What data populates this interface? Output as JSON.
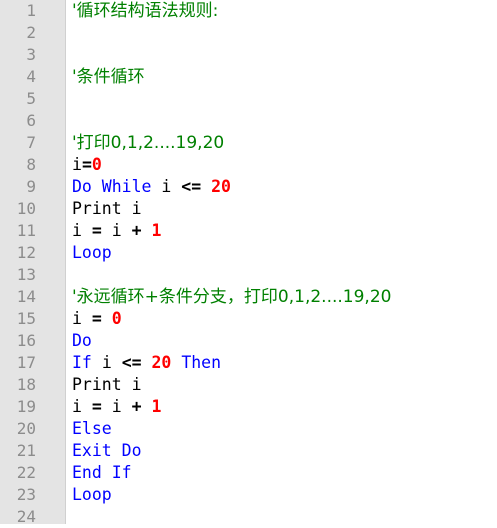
{
  "editor": {
    "lines": [
      {
        "num": "1",
        "tokens": [
          {
            "t": "comment",
            "v": "'循环结构语法规则:"
          }
        ]
      },
      {
        "num": "2",
        "tokens": []
      },
      {
        "num": "3",
        "tokens": []
      },
      {
        "num": "4",
        "tokens": [
          {
            "t": "comment",
            "v": "'条件循环"
          }
        ]
      },
      {
        "num": "5",
        "tokens": []
      },
      {
        "num": "6",
        "tokens": []
      },
      {
        "num": "7",
        "tokens": [
          {
            "t": "comment",
            "v": "'打印0,1,2....19,20"
          }
        ]
      },
      {
        "num": "8",
        "tokens": [
          {
            "t": "ident",
            "v": "i"
          },
          {
            "t": "op",
            "v": "="
          },
          {
            "t": "number",
            "v": "0"
          }
        ]
      },
      {
        "num": "9",
        "tokens": [
          {
            "t": "keyword",
            "v": "Do While"
          },
          {
            "t": "ws",
            "v": " "
          },
          {
            "t": "ident",
            "v": "i"
          },
          {
            "t": "ws",
            "v": " "
          },
          {
            "t": "op",
            "v": "<="
          },
          {
            "t": "ws",
            "v": " "
          },
          {
            "t": "number",
            "v": "20"
          }
        ]
      },
      {
        "num": "10",
        "tokens": [
          {
            "t": "ident",
            "v": "Print i"
          }
        ]
      },
      {
        "num": "11",
        "tokens": [
          {
            "t": "ident",
            "v": "i"
          },
          {
            "t": "ws",
            "v": " "
          },
          {
            "t": "op",
            "v": "="
          },
          {
            "t": "ws",
            "v": " "
          },
          {
            "t": "ident",
            "v": "i"
          },
          {
            "t": "ws",
            "v": " "
          },
          {
            "t": "op",
            "v": "+"
          },
          {
            "t": "ws",
            "v": " "
          },
          {
            "t": "number",
            "v": "1"
          }
        ]
      },
      {
        "num": "12",
        "tokens": [
          {
            "t": "keyword",
            "v": "Loop"
          }
        ]
      },
      {
        "num": "13",
        "tokens": []
      },
      {
        "num": "14",
        "tokens": [
          {
            "t": "comment",
            "v": "'永远循环+条件分支，打印0,1,2....19,20"
          }
        ]
      },
      {
        "num": "15",
        "tokens": [
          {
            "t": "ident",
            "v": "i"
          },
          {
            "t": "ws",
            "v": " "
          },
          {
            "t": "op",
            "v": "="
          },
          {
            "t": "ws",
            "v": " "
          },
          {
            "t": "number",
            "v": "0"
          }
        ]
      },
      {
        "num": "16",
        "tokens": [
          {
            "t": "keyword",
            "v": "Do"
          }
        ]
      },
      {
        "num": "17",
        "tokens": [
          {
            "t": "keyword",
            "v": "If"
          },
          {
            "t": "ws",
            "v": " "
          },
          {
            "t": "ident",
            "v": "i"
          },
          {
            "t": "ws",
            "v": " "
          },
          {
            "t": "op",
            "v": "<="
          },
          {
            "t": "ws",
            "v": " "
          },
          {
            "t": "number",
            "v": "20"
          },
          {
            "t": "ws",
            "v": " "
          },
          {
            "t": "keyword",
            "v": "Then"
          }
        ]
      },
      {
        "num": "18",
        "tokens": [
          {
            "t": "ident",
            "v": "Print i"
          }
        ]
      },
      {
        "num": "19",
        "tokens": [
          {
            "t": "ident",
            "v": "i"
          },
          {
            "t": "ws",
            "v": " "
          },
          {
            "t": "op",
            "v": "="
          },
          {
            "t": "ws",
            "v": " "
          },
          {
            "t": "ident",
            "v": "i"
          },
          {
            "t": "ws",
            "v": " "
          },
          {
            "t": "op",
            "v": "+"
          },
          {
            "t": "ws",
            "v": " "
          },
          {
            "t": "number",
            "v": "1"
          }
        ]
      },
      {
        "num": "20",
        "tokens": [
          {
            "t": "keyword",
            "v": "Else"
          }
        ]
      },
      {
        "num": "21",
        "tokens": [
          {
            "t": "keyword",
            "v": "Exit Do"
          }
        ]
      },
      {
        "num": "22",
        "tokens": [
          {
            "t": "keyword",
            "v": "End If"
          }
        ]
      },
      {
        "num": "23",
        "tokens": [
          {
            "t": "keyword",
            "v": "Loop"
          }
        ]
      },
      {
        "num": "24",
        "tokens": []
      }
    ],
    "colors": {
      "gutter": "#e4e4e4",
      "line_number": "#8c8c8c",
      "comment": "#008000",
      "keyword": "#0000ff",
      "number": "#ff0000",
      "text": "#000000"
    }
  }
}
